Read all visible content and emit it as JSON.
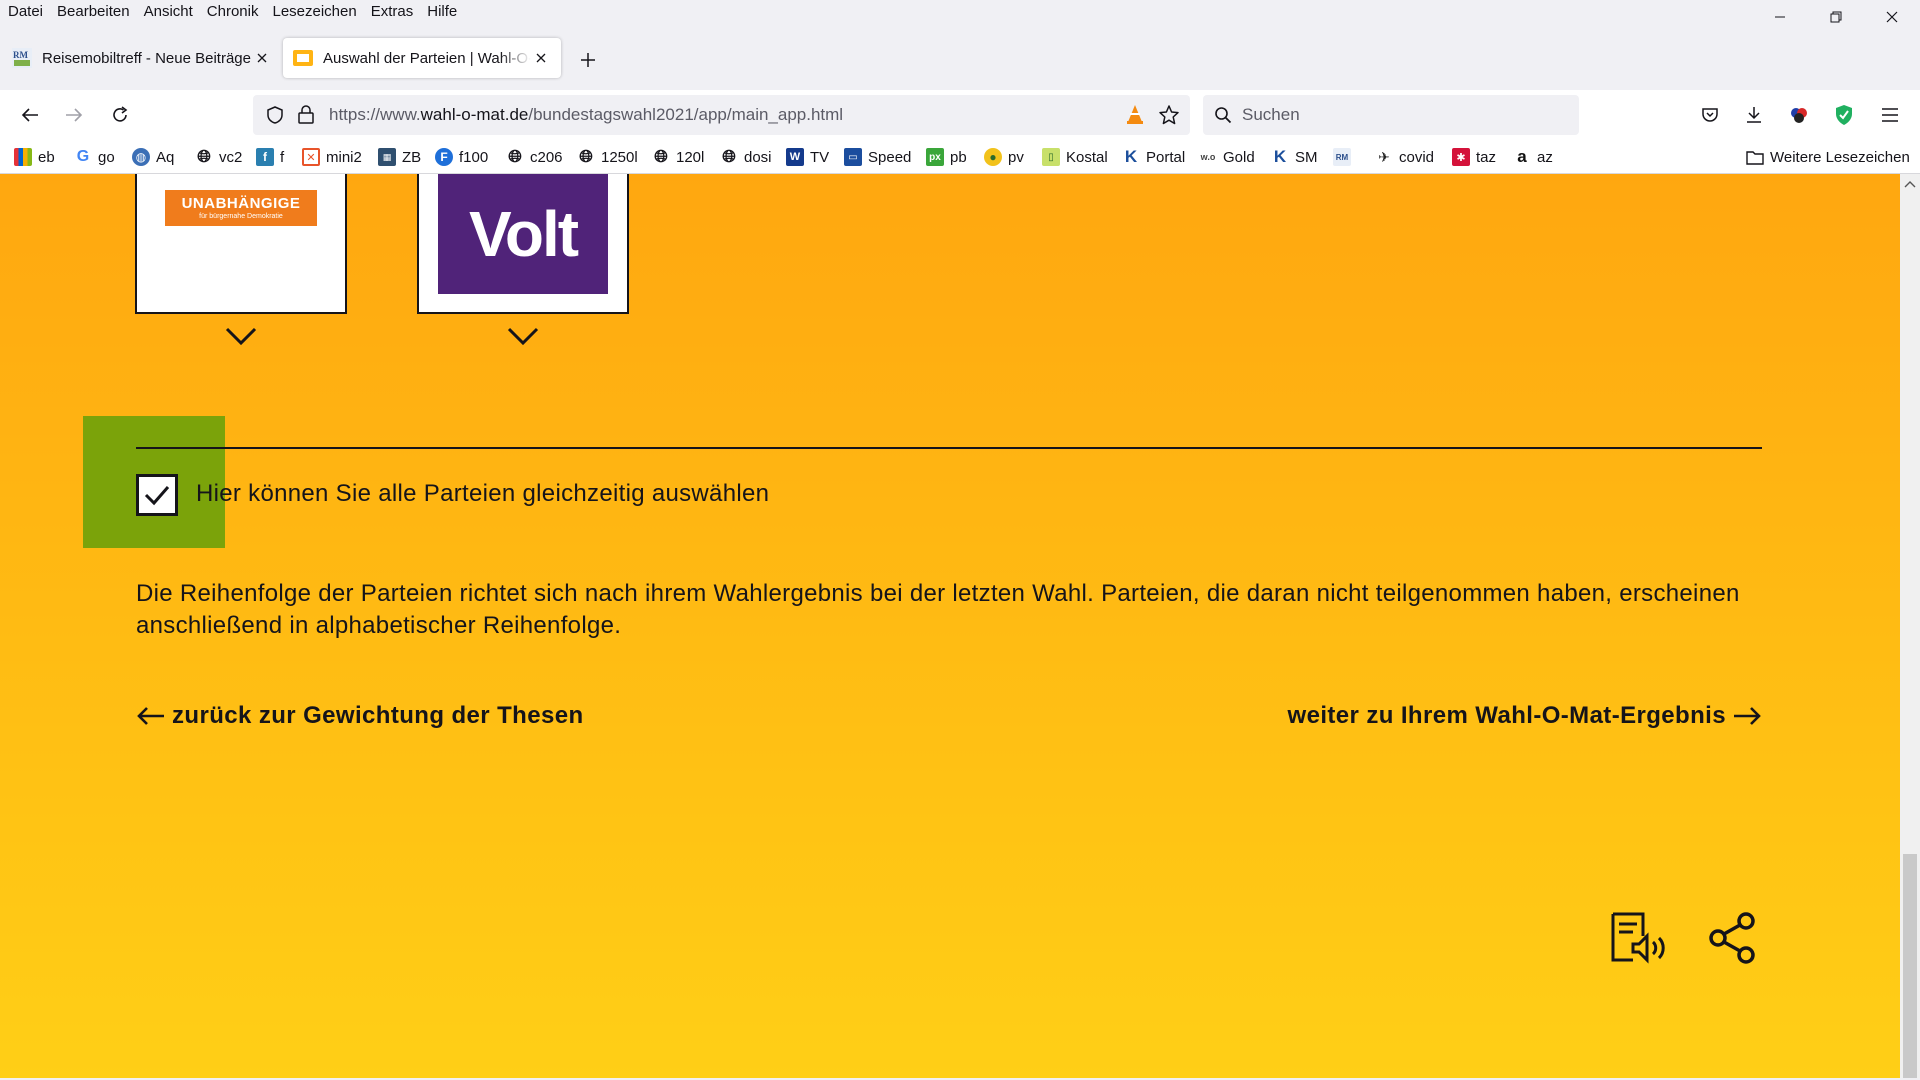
{
  "menubar": {
    "items": [
      "Datei",
      "Bearbeiten",
      "Ansicht",
      "Chronik",
      "Lesezeichen",
      "Extras",
      "Hilfe"
    ]
  },
  "tabs": [
    {
      "label": "Reisemobiltreff - Neue Beiträge",
      "favicon": "rm-logo-icon"
    },
    {
      "label": "Auswahl der Parteien | Wahl-O-Mat",
      "favicon": "wahl-o-mat-icon"
    }
  ],
  "urlbar": {
    "prefix": "https://www.",
    "host": "wahl-o-mat.de",
    "path": "/bundestagswahl2021/app/main_app.html"
  },
  "searchbar": {
    "placeholder": "Suchen"
  },
  "bookmarks": {
    "items": [
      "eb",
      "go",
      "Aq",
      "vc2",
      "f",
      "mini2",
      "ZB",
      "f100",
      "c206",
      "1250l",
      "120l",
      "dosi",
      "TV",
      "Speed",
      "pb",
      "pv",
      "Kostal",
      "Portal",
      "Gold",
      "SM",
      "",
      "covid",
      "taz",
      "az"
    ],
    "other": "Weitere Lesezeichen"
  },
  "parties": [
    {
      "logo_text": "UNABHÄNGIGE",
      "logo_subtext": "für bürgernahe Demokratie",
      "logo_bg": "#f07c1c"
    },
    {
      "logo_text": "Volt",
      "logo_bg": "#502379"
    }
  ],
  "content": {
    "select_all_label": "Hier können Sie alle Parteien gleichzeitig auswählen",
    "select_all_checked": true,
    "order_note": "Die Reihenfolge der Parteien richtet sich nach ihrem Wahlergebnis bei der letzten Wahl. Parteien, die daran nicht teilgenommen haben, erscheinen anschließend in alphabetischer Reihenfolge.",
    "back_link": "zurück zur Gewichtung der Thesen",
    "next_link": "weiter zu Ihrem Wahl-O-Mat-Ergebnis"
  },
  "colors": {
    "page_top": "#ffa710",
    "page_bottom": "#ffcf16",
    "focus_highlight": "#7ba30a",
    "text": "#15141a"
  }
}
